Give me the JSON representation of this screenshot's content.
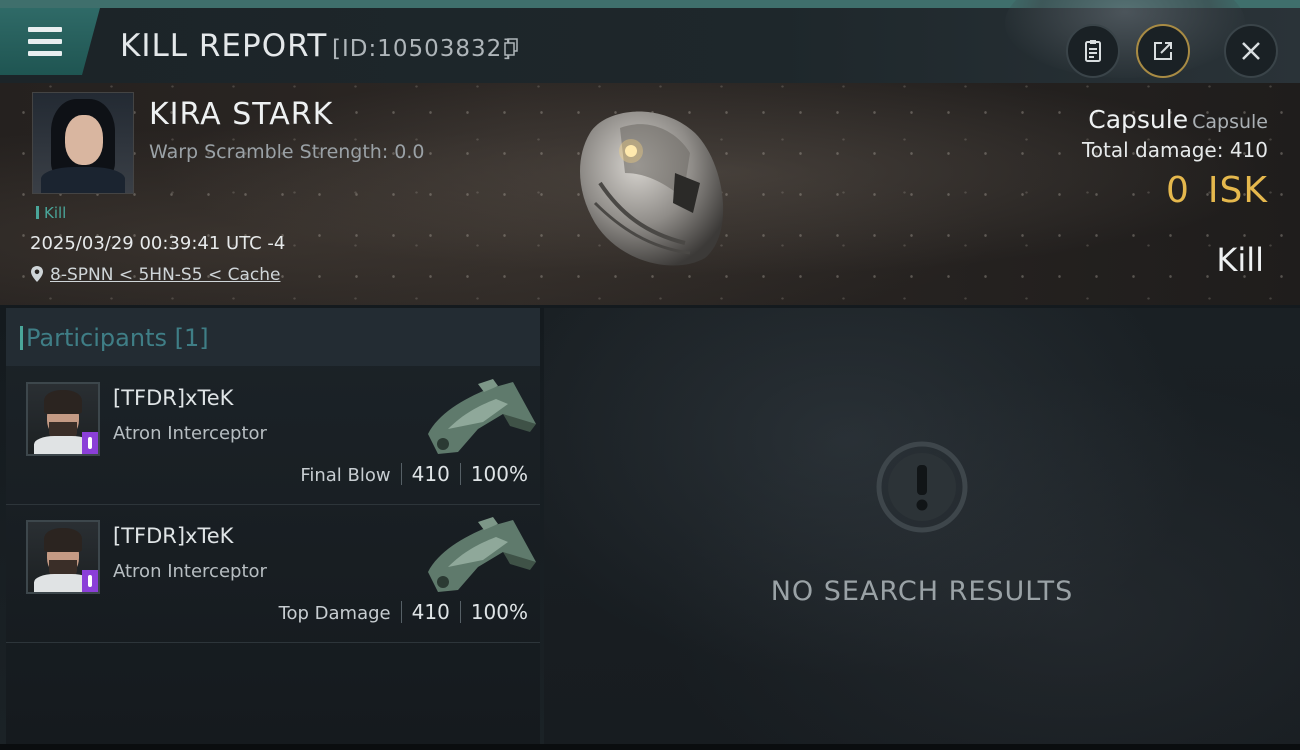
{
  "header": {
    "title": "KILL REPORT",
    "id_text": "[ID:10503832]"
  },
  "victim": {
    "name": "KIRA STARK",
    "warp_scramble": "Warp Scramble Strength: 0.0",
    "kill_tag": "Kill",
    "datetime": "2025/03/29 00:39:41 UTC -4",
    "location": "8-SPNN < 5HN-S5 < Cache"
  },
  "summary": {
    "ship_name": "Capsule",
    "ship_type": "Capsule",
    "total_damage_label": "Total damage:",
    "total_damage": "410",
    "isk_value": "0",
    "isk_unit": "ISK",
    "result": "Kill"
  },
  "participants": {
    "title": "Participants",
    "count_text": "[1]",
    "rows": [
      {
        "name": "[TFDR]xTeK",
        "ship": "Atron Interceptor",
        "label": "Final Blow",
        "damage": "410",
        "percent": "100%"
      },
      {
        "name": "[TFDR]xTeK",
        "ship": "Atron Interceptor",
        "label": "Top Damage",
        "damage": "410",
        "percent": "100%"
      }
    ]
  },
  "results": {
    "empty_text": "NO SEARCH RESULTS"
  },
  "colors": {
    "accent_teal": "#3f6f6c",
    "isk_gold": "#e5b84d",
    "corp_purple": "#8b3fd8"
  },
  "icons": [
    "menu-icon",
    "copy-icon",
    "clipboard-icon",
    "share-icon",
    "close-icon",
    "location-pin-icon",
    "exclamation-icon"
  ]
}
